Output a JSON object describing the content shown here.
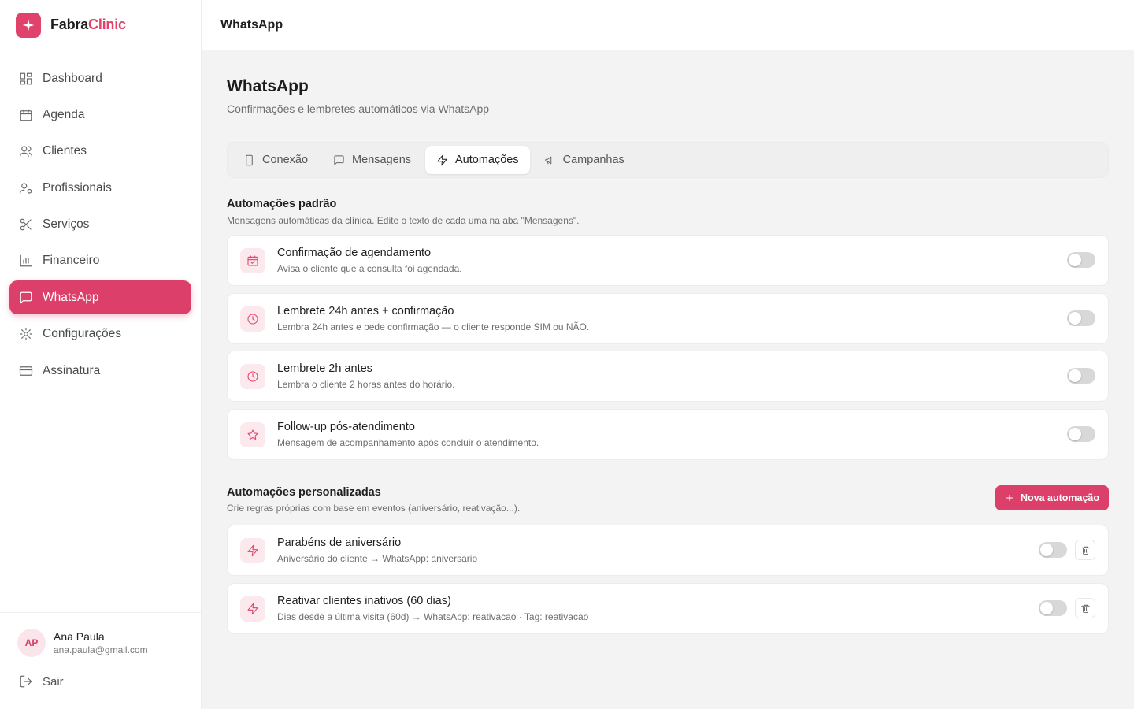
{
  "brand": {
    "name_part1": "Fabra",
    "name_part2": "Clinic",
    "accent": "#e0426c"
  },
  "sidebar": {
    "items": [
      {
        "label": "Dashboard",
        "icon": "dashboard-icon"
      },
      {
        "label": "Agenda",
        "icon": "calendar-icon"
      },
      {
        "label": "Clientes",
        "icon": "users-icon"
      },
      {
        "label": "Profissionais",
        "icon": "user-settings-icon"
      },
      {
        "label": "Serviços",
        "icon": "scissors-icon"
      },
      {
        "label": "Financeiro",
        "icon": "bar-chart-icon"
      },
      {
        "label": "WhatsApp",
        "icon": "chat-icon",
        "active": true
      },
      {
        "label": "Configurações",
        "icon": "gear-icon"
      },
      {
        "label": "Assinatura",
        "icon": "credit-card-icon"
      }
    ]
  },
  "user": {
    "initials": "AP",
    "name": "Ana Paula",
    "email": "ana.paula@gmail.com"
  },
  "logout_label": "Sair",
  "header": {
    "title": "WhatsApp"
  },
  "page": {
    "title": "WhatsApp",
    "subtitle": "Confirmações e lembretes automáticos via WhatsApp"
  },
  "tabs": [
    {
      "label": "Conexão",
      "icon": "phone-icon"
    },
    {
      "label": "Mensagens",
      "icon": "chat-icon"
    },
    {
      "label": "Automações",
      "icon": "bolt-icon",
      "active": true
    },
    {
      "label": "Campanhas",
      "icon": "megaphone-icon"
    }
  ],
  "default_section": {
    "title": "Automações padrão",
    "description": "Mensagens automáticas da clínica. Edite o texto de cada uma na aba \"Mensagens\".",
    "items": [
      {
        "title": "Confirmação de agendamento",
        "description": "Avisa o cliente que a consulta foi agendada.",
        "icon": "calendar-check-icon",
        "enabled": false
      },
      {
        "title": "Lembrete 24h antes + confirmação",
        "description": "Lembra 24h antes e pede confirmação — o cliente responde SIM ou NÃO.",
        "icon": "clock-icon",
        "enabled": false
      },
      {
        "title": "Lembrete 2h antes",
        "description": "Lembra o cliente 2 horas antes do horário.",
        "icon": "clock-icon",
        "enabled": false
      },
      {
        "title": "Follow-up pós-atendimento",
        "description": "Mensagem de acompanhamento após concluir o atendimento.",
        "icon": "star-icon",
        "enabled": false
      }
    ]
  },
  "custom_section": {
    "title": "Automações personalizadas",
    "description": "Crie regras próprias com base em eventos (aniversário, reativação...).",
    "new_button_label": "Nova automação",
    "items": [
      {
        "title": "Parabéns de aniversário",
        "description": "Aniversário do cliente → WhatsApp: aniversario",
        "icon": "bolt-icon",
        "enabled": false
      },
      {
        "title": "Reativar clientes inativos (60 dias)",
        "description": "Dias desde a última visita (60d) → WhatsApp: reativacao · Tag: reativacao",
        "icon": "bolt-icon",
        "enabled": false
      }
    ]
  }
}
